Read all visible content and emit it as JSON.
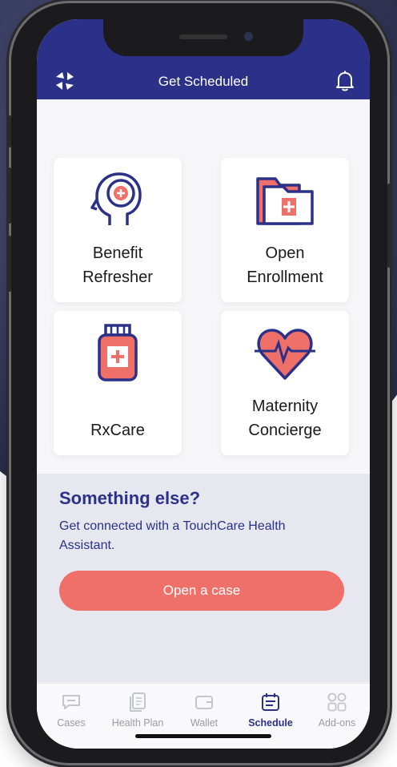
{
  "header": {
    "title": "Get Scheduled",
    "logo_icon": "touchcare-logo-icon",
    "bell_icon": "bell-icon"
  },
  "cards": [
    {
      "id": "benefit",
      "label_lines": [
        "Benefit",
        "Refresher"
      ],
      "icon": "head-plus-icon"
    },
    {
      "id": "enrollment",
      "label_lines": [
        "Open",
        "Enrollment"
      ],
      "icon": "folder-plus-icon"
    },
    {
      "id": "rx",
      "label_lines": [
        "RxCare"
      ],
      "icon": "pill-bottle-icon"
    },
    {
      "id": "maternity",
      "label_lines": [
        "Maternity",
        "Concierge"
      ],
      "icon": "heart-pulse-icon"
    }
  ],
  "else_section": {
    "heading": "Something else?",
    "text": "Get connected with a TouchCare Health Assistant.",
    "button": "Open a case"
  },
  "tabs": [
    {
      "label": "Cases",
      "icon": "chat-icon",
      "active": false
    },
    {
      "label": "Health Plan",
      "icon": "document-icon",
      "active": false
    },
    {
      "label": "Wallet",
      "icon": "wallet-icon",
      "active": false
    },
    {
      "label": "Schedule",
      "icon": "calendar-icon",
      "active": true
    },
    {
      "label": "Add-ons",
      "icon": "grid-icon",
      "active": false
    }
  ],
  "colors": {
    "primary": "#2b3088",
    "accent": "#ef6f69",
    "inactive": "#9a9aa6"
  }
}
